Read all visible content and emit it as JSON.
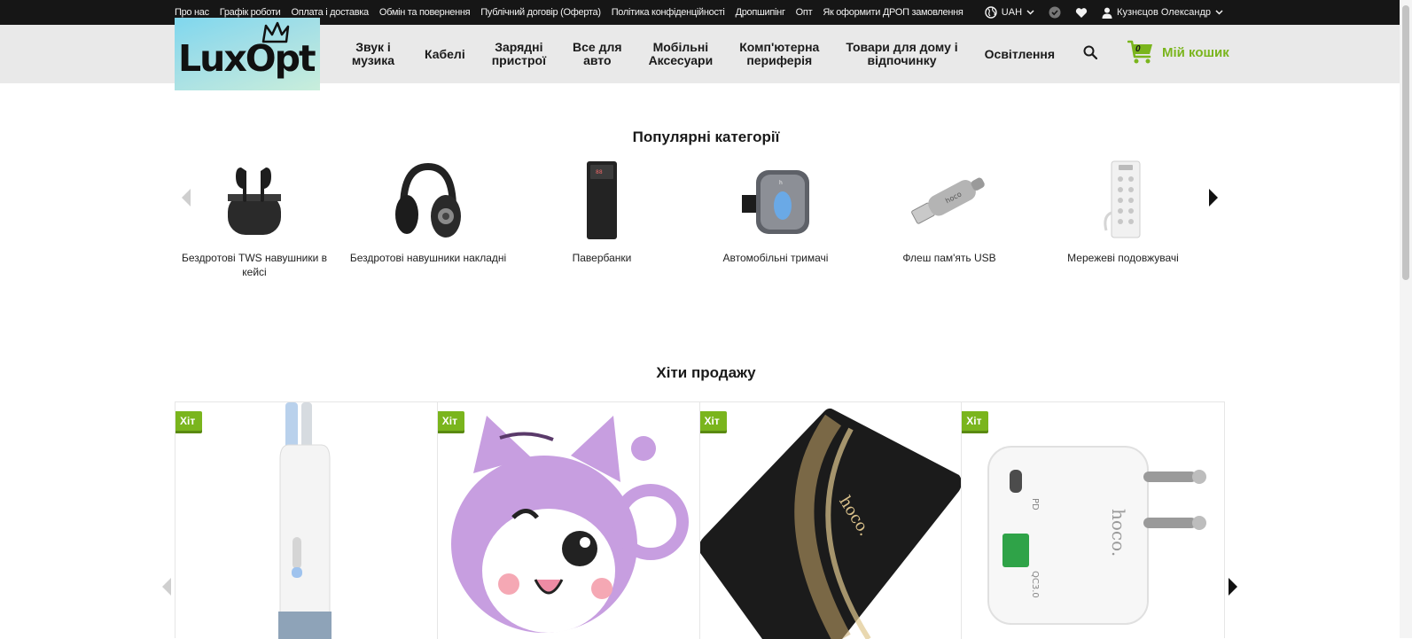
{
  "topbar": {
    "links": [
      "Про нас",
      "Графік роботи",
      "Оплата і доставка",
      "Обмін та повернення",
      "Публічний договір (Оферта)",
      "Політика конфіденційності",
      "Дропшипінг",
      "Опт",
      "Як оформити ДРОП замовлення"
    ],
    "currency": "UAH",
    "user_name": "Кузнєцов Олександр"
  },
  "header": {
    "logo_text": "LuxOpt",
    "nav": [
      "Звук і\nмузика",
      "Кабелі",
      "Зарядні\nпристрої",
      "Все для\nавто",
      "Мобільні\nАксесуари",
      "Комп'ютерна\nпериферія",
      "Товари для дому і\nвідпочинку",
      "Освітлення"
    ],
    "cart_count": "0",
    "cart_label": "Мій кошик"
  },
  "popular": {
    "title": "Популярні категорії",
    "items": [
      {
        "label": "Бездротові TWS навушники в кейсі",
        "icon": "tws-earbuds-icon"
      },
      {
        "label": "Бездротові навушники накладні",
        "icon": "headphones-icon"
      },
      {
        "label": "Павербанки",
        "icon": "powerbank-icon"
      },
      {
        "label": "Автомобільні тримачі",
        "icon": "car-holder-icon"
      },
      {
        "label": "Флеш пам'ять USB",
        "icon": "usb-flash-icon"
      },
      {
        "label": "Мережеві подовжувачі",
        "icon": "power-strip-icon"
      }
    ]
  },
  "hits": {
    "title": "Хіти продажу",
    "badge": "Хіт",
    "products": [
      {
        "icon": "cleaning-kit-icon"
      },
      {
        "icon": "cat-earbuds-case-icon"
      },
      {
        "icon": "wireless-charger-icon"
      },
      {
        "icon": "wall-charger-icon",
        "labels": [
          "PD",
          "QC3.0",
          "hoco."
        ]
      }
    ],
    "brand_text": "hoco."
  },
  "colors": {
    "accent": "#7ab51d",
    "topbar": "#161616",
    "header": "#e9e9e9"
  }
}
